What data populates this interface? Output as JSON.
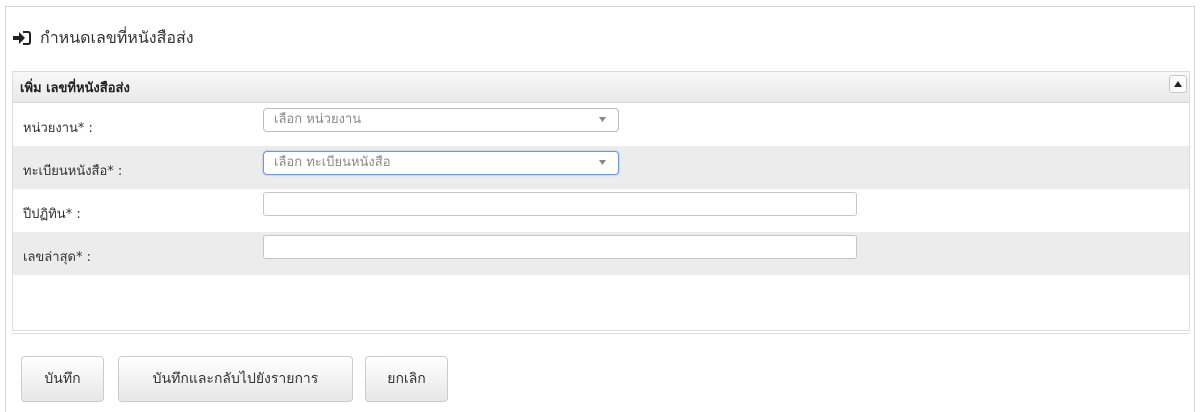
{
  "header": {
    "title": "กำหนดเลขที่หนังสือส่ง",
    "icon": "sign-in-arrow-icon"
  },
  "panel": {
    "title": "เพิ่ม เลขที่หนังสือส่ง",
    "collapse_icon": "caret-up-icon",
    "fields": [
      {
        "label": "หน่วยงาน* :",
        "type": "select",
        "value": "เลือก หน่วยงาน"
      },
      {
        "label": "ทะเบียนหนังสือ* :",
        "type": "select",
        "value": "เลือก ทะเบียนหนังสือ"
      },
      {
        "label": "ปีปฏิทิน* :",
        "type": "text",
        "value": ""
      },
      {
        "label": "เลขล่าสุด* :",
        "type": "text",
        "value": ""
      }
    ]
  },
  "buttons": {
    "save": "บันทึก",
    "save_back": "บันทึกและกลับไปยังรายการ",
    "cancel": "ยกเลิก"
  },
  "colors": {
    "panel_header_bg": "#ebebeb",
    "alt_row_bg": "#ececec",
    "focus_border": "#6a9ad8"
  }
}
